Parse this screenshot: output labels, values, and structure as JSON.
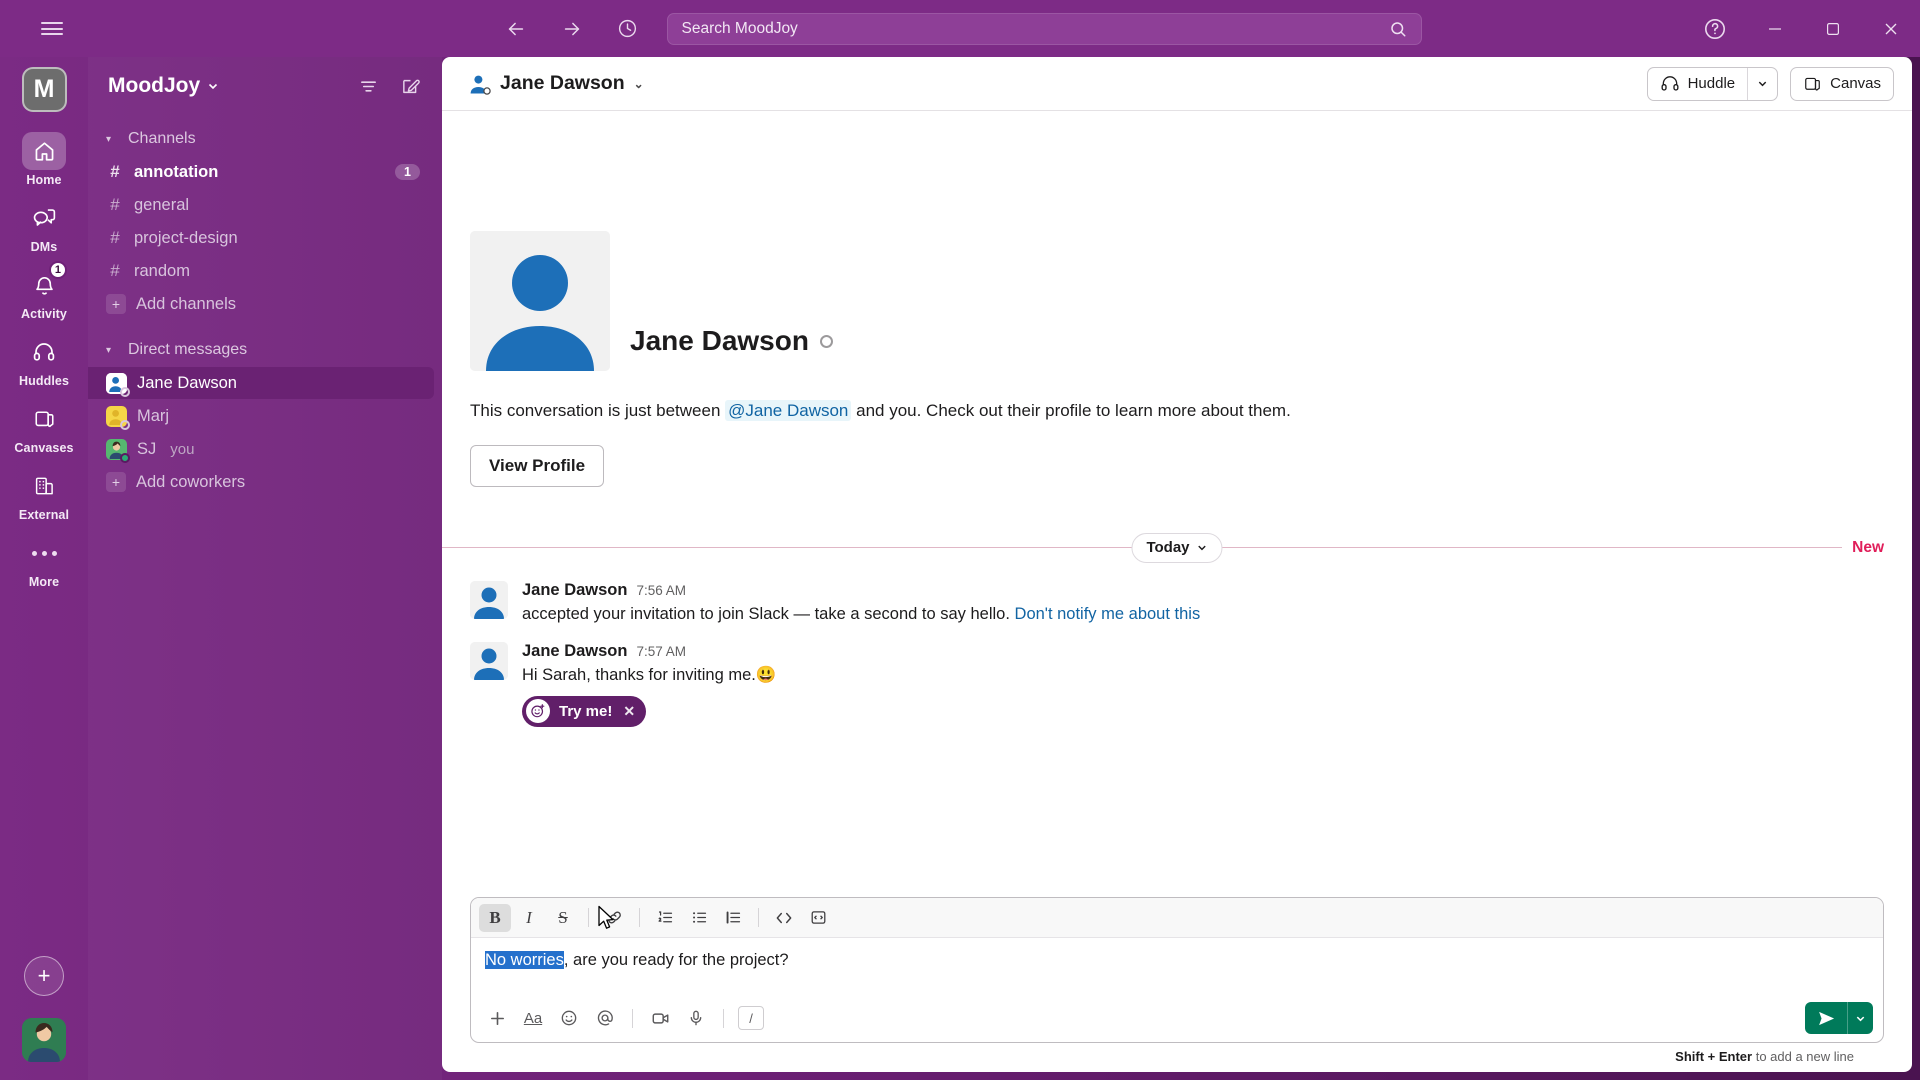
{
  "titlebar": {
    "hamburger": "menu-icon",
    "back": "back-arrow",
    "forward": "forward-arrow",
    "history": "clock-icon",
    "search_placeholder": "Search MoodJoy",
    "help": "?",
    "minimize": "minimize",
    "maximize": "maximize",
    "close": "close"
  },
  "rail": {
    "workspace_initial": "M",
    "items": [
      {
        "label": "Home",
        "icon": "home-icon",
        "active": true,
        "badge": ""
      },
      {
        "label": "DMs",
        "icon": "dms-icon",
        "active": false,
        "badge": ""
      },
      {
        "label": "Activity",
        "icon": "bell-icon",
        "active": false,
        "badge": "1"
      },
      {
        "label": "Huddles",
        "icon": "headphones-icon",
        "active": false,
        "badge": ""
      },
      {
        "label": "Canvases",
        "icon": "canvas-icon",
        "active": false,
        "badge": ""
      },
      {
        "label": "External",
        "icon": "building-icon",
        "active": false,
        "badge": ""
      },
      {
        "label": "More",
        "icon": "ellipsis-icon",
        "active": false,
        "badge": ""
      }
    ],
    "new_label": "+"
  },
  "sidebar": {
    "workspace_name": "MoodJoy",
    "filter_icon": "filter-icon",
    "compose_icon": "compose-icon",
    "sections": [
      {
        "name": "Channels",
        "items": [
          {
            "label": "annotation",
            "prefix": "#",
            "unread": true,
            "badge": "1"
          },
          {
            "label": "general",
            "prefix": "#",
            "unread": false,
            "badge": ""
          },
          {
            "label": "project-design",
            "prefix": "#",
            "unread": false,
            "badge": ""
          },
          {
            "label": "random",
            "prefix": "#",
            "unread": false,
            "badge": ""
          },
          {
            "label": "Add channels",
            "prefix": "+",
            "unread": false,
            "badge": ""
          }
        ]
      },
      {
        "name": "Direct messages",
        "items": [
          {
            "label": "Jane Dawson",
            "prefix": "avatar-blue",
            "selected": true,
            "presence": "away",
            "suffix": ""
          },
          {
            "label": "Marj",
            "prefix": "avatar-yellow",
            "selected": false,
            "presence": "away",
            "suffix": ""
          },
          {
            "label": "SJ",
            "prefix": "avatar-green",
            "selected": false,
            "presence": "on",
            "suffix": "you"
          },
          {
            "label": "Add coworkers",
            "prefix": "+",
            "selected": false,
            "presence": "",
            "suffix": ""
          }
        ]
      }
    ]
  },
  "conversation": {
    "title": "Jane Dawson",
    "huddle_label": "Huddle",
    "canvas_label": "Canvas",
    "intro": {
      "name": "Jane Dawson",
      "desc_before": "This conversation is just between ",
      "mention": "@Jane Dawson",
      "desc_after": " and you. Check out their profile to learn more about them.",
      "view_profile": "View Profile"
    },
    "divider": {
      "today": "Today",
      "new": "New"
    },
    "messages": [
      {
        "author": "Jane Dawson",
        "time": "7:56 AM",
        "text": "accepted your invitation to join Slack — take a second to say hello. ",
        "link": "Don't notify me about this",
        "reaction": ""
      },
      {
        "author": "Jane Dawson",
        "time": "7:57 AM",
        "text": "Hi Sarah, thanks for inviting me.",
        "emoji": "😃",
        "link": "",
        "reaction": "Try me!"
      }
    ]
  },
  "composer": {
    "toolbar": [
      {
        "name": "bold",
        "glyph": "B",
        "active": true
      },
      {
        "name": "italic",
        "glyph": "I",
        "active": false
      },
      {
        "name": "strikethrough",
        "glyph": "S",
        "active": false
      },
      {
        "name": "link",
        "glyph": "link-icon",
        "active": false
      },
      {
        "name": "ordered-list",
        "glyph": "ol-icon",
        "active": false
      },
      {
        "name": "bulleted-list",
        "glyph": "ul-icon",
        "active": false
      },
      {
        "name": "blockquote",
        "glyph": "quote-icon",
        "active": false
      },
      {
        "name": "code",
        "glyph": "code-icon",
        "active": false
      },
      {
        "name": "code-block",
        "glyph": "codeblock-icon",
        "active": false
      }
    ],
    "selected_text": "No worries",
    "rest_text": ", are you ready for the project?",
    "footer_icons": [
      "plus-icon",
      "format-icon",
      "emoji-icon",
      "mention-icon",
      "video-icon",
      "mic-icon",
      "slash-icon"
    ],
    "hint_bold": "Shift + Enter",
    "hint_rest": " to add a new line"
  },
  "colors": {
    "brand_purple": "#611F69",
    "sidebar_selected": "#6A2273",
    "send_green": "#007A5A",
    "new_red": "#E01E5A",
    "link_blue": "#1264A3"
  }
}
